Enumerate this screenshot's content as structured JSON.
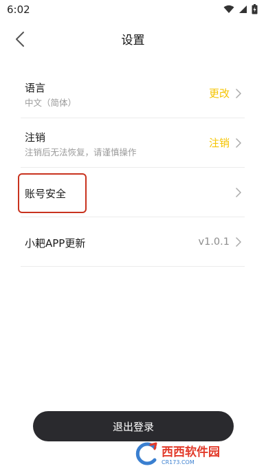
{
  "status_bar": {
    "time": "6:02"
  },
  "header": {
    "title": "设置"
  },
  "rows": [
    {
      "title": "语言",
      "subtitle": "中文（简体）",
      "action": "更改"
    },
    {
      "title": "注销",
      "subtitle": "注销后无法恢复，请谨慎操作",
      "action": "注销"
    },
    {
      "title": "账号安全"
    },
    {
      "title": "小耙APP更新",
      "version": "v1.0.1"
    }
  ],
  "logout_label": "退出登录",
  "watermark": {
    "text": "西西软件园",
    "sub": "CR173.COM"
  },
  "colors": {
    "accent": "#f5c400",
    "button_bg": "#2a2a2e",
    "highlight": "#c8321e"
  }
}
